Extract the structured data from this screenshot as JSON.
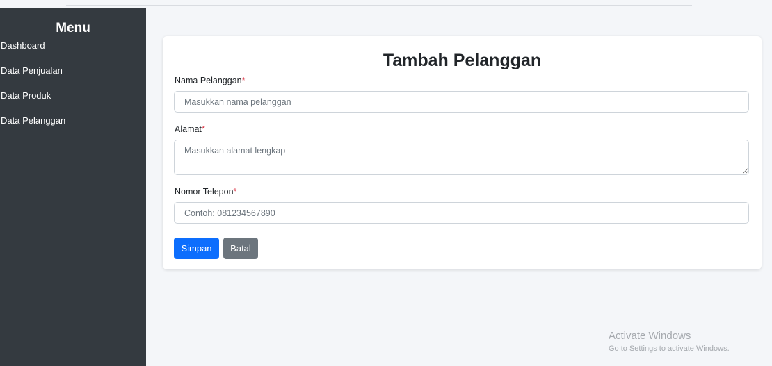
{
  "sidebar": {
    "title": "Menu",
    "items": [
      {
        "label": "Dashboard"
      },
      {
        "label": "Data Penjualan"
      },
      {
        "label": "Data Produk"
      },
      {
        "label": "Data Pelanggan"
      }
    ]
  },
  "form": {
    "title": "Tambah Pelanggan",
    "required_marker": "*",
    "fields": {
      "nama": {
        "label": "Nama Pelanggan",
        "placeholder": "Masukkan nama pelanggan",
        "value": ""
      },
      "alamat": {
        "label": "Alamat",
        "placeholder": "Masukkan alamat lengkap",
        "value": ""
      },
      "telepon": {
        "label": "Nomor Telepon",
        "placeholder": "Contoh: 081234567890",
        "value": ""
      }
    },
    "buttons": {
      "save": "Simpan",
      "cancel": "Batal"
    }
  },
  "watermark": {
    "title": "Activate Windows",
    "subtitle": "Go to Settings to activate Windows."
  },
  "colors": {
    "sidebar_bg": "#343a40",
    "primary": "#0d6efd",
    "secondary": "#6c757d",
    "required": "#dc3545",
    "page_bg": "#f4f6f9"
  }
}
